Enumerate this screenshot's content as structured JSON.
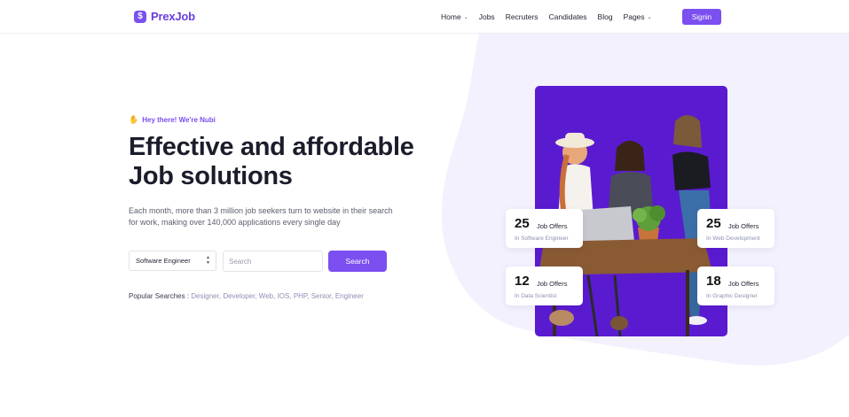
{
  "brand": {
    "logo_glyph": "$",
    "name": "PrexJob",
    "color": "#7b4ff0"
  },
  "nav": {
    "items": [
      {
        "label": "Home",
        "has_dropdown": true
      },
      {
        "label": "Jobs",
        "has_dropdown": false
      },
      {
        "label": "Recruters",
        "has_dropdown": false
      },
      {
        "label": "Candidates",
        "has_dropdown": false
      },
      {
        "label": "Blog",
        "has_dropdown": false
      },
      {
        "label": "Pages",
        "has_dropdown": true
      }
    ],
    "signin_label": "Signin"
  },
  "hero": {
    "greeting_icon": "waving-hand-icon",
    "greeting": "Hey there! We're Nubi",
    "headline_line1": "Effective and affordable",
    "headline_line2": "Job solutions",
    "description": "Each month, more than 3 million job seekers turn to website in their search for work, making over 140,000 applications every single day"
  },
  "search": {
    "select_value": "Software Engineer",
    "input_placeholder": "Search",
    "input_value": "",
    "button_label": "Search"
  },
  "popular": {
    "label": "Popular Searches :",
    "terms": [
      "Designer,",
      "Developer,",
      "Web,",
      "IOS,",
      "PHP,",
      "Senior,",
      "Engineer"
    ]
  },
  "stats": [
    {
      "count": "25",
      "label": "Job Offers",
      "sub": "In Software Engineer"
    },
    {
      "count": "25",
      "label": "Job Offers",
      "sub": "In Web Development"
    },
    {
      "count": "12",
      "label": "Job Offers",
      "sub": "In Data Scientist"
    },
    {
      "count": "18",
      "label": "Job Offers",
      "sub": "In Graphic Designer"
    }
  ],
  "colors": {
    "accent": "#7b4ff0",
    "photo_bg": "#5a1bd0",
    "blob": "#f3f1fd"
  }
}
